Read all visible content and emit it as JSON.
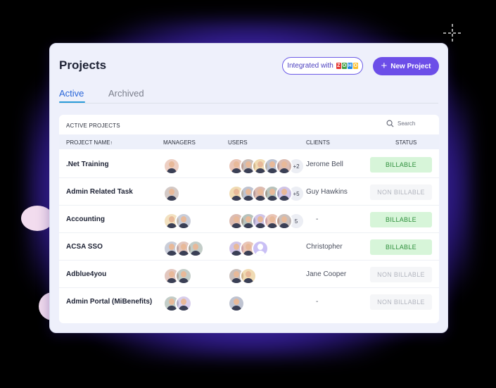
{
  "header": {
    "title": "Projects",
    "integrated_label": "Integrated with",
    "integration_logo_letters": [
      "Z",
      "O",
      "H",
      "O"
    ],
    "integration_logo_colors": [
      "#e53935",
      "#43a047",
      "#1e88e5",
      "#fbc02d"
    ],
    "new_project_label": "New Project"
  },
  "tabs": {
    "active": "Active",
    "archived": "Archived"
  },
  "panel": {
    "heading": "ACTIVE PROJECTS",
    "search_placeholder": "Search"
  },
  "columns": {
    "project_name": "PROJECT NAME",
    "managers": "MANAGERS",
    "users": "USERS",
    "clients": "CLIENTS",
    "status": "STATUS"
  },
  "rows": [
    {
      "name": ".Net Training",
      "managers": 1,
      "users": 5,
      "users_more": "+2",
      "client": "Jerome Bell",
      "status": "BILLABLE"
    },
    {
      "name": "Admin Related Task",
      "managers": 1,
      "users": 5,
      "users_more": "+5",
      "client": "Guy Hawkins",
      "status": "NON BILLABLE"
    },
    {
      "name": "Accounting",
      "managers": 2,
      "users": 5,
      "users_more": "5",
      "client": "-",
      "status": "BILLABLE"
    },
    {
      "name": "ACSA SSO",
      "managers": 3,
      "users": 3,
      "users_more": "",
      "client": "Christopher",
      "status": "BILLABLE"
    },
    {
      "name": "Adblue4you",
      "managers": 2,
      "users": 2,
      "users_more": "",
      "client": "Jane Cooper",
      "status": "NON BILLABLE"
    },
    {
      "name": "Admin Portal (MiBenefits)",
      "managers": 2,
      "users": 1,
      "users_more": "",
      "client": "-",
      "status": "NON BILLABLE"
    }
  ],
  "colors": {
    "accent": "#6c4ee8",
    "billable_bg": "#d7f5d9",
    "billable_text": "#2e8f3b",
    "nonbillable_bg": "#f5f6f8",
    "nonbillable_text": "#b3b6bf"
  }
}
